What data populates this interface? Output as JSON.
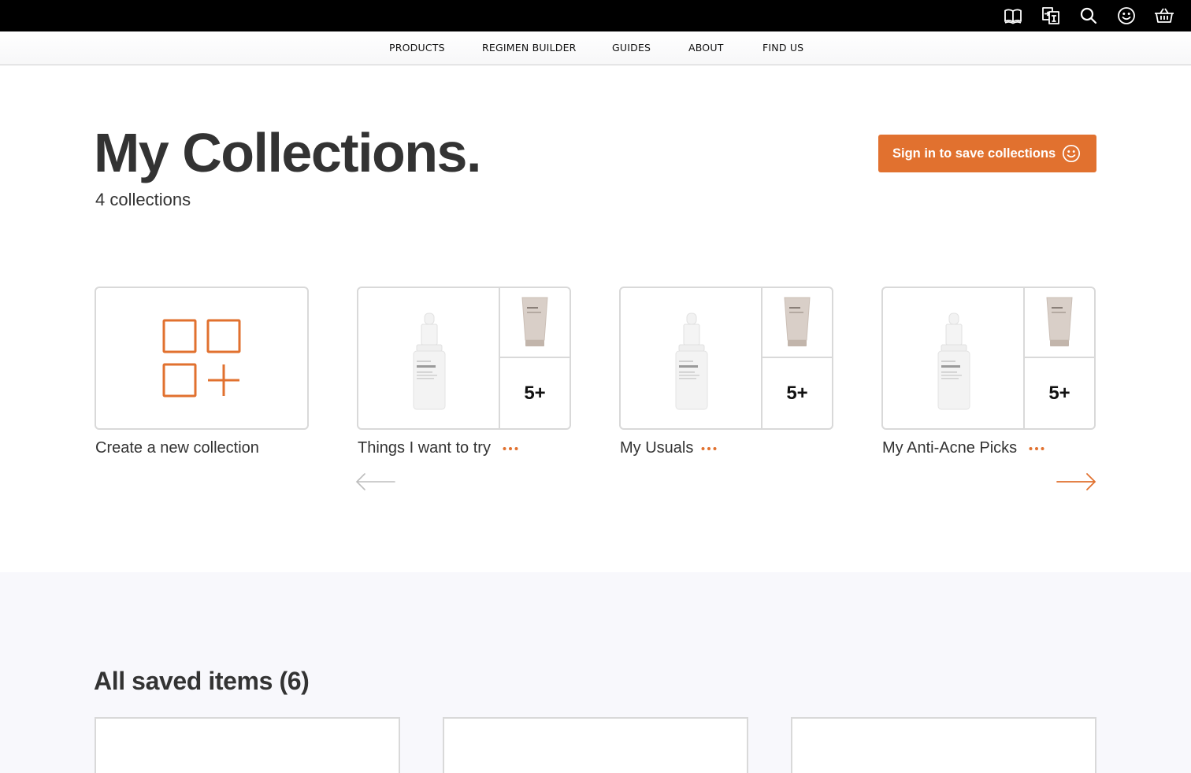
{
  "header": {
    "icons": [
      "book-icon",
      "translate-icon",
      "search-icon",
      "account-smiley-icon",
      "basket-icon"
    ]
  },
  "nav": {
    "items": [
      "PRODUCTS",
      "REGIMEN BUILDER",
      "GUIDES",
      "ABOUT",
      "FIND US"
    ]
  },
  "page": {
    "title": "My Collections.",
    "subtitle": "4 collections"
  },
  "signin": {
    "label": "Sign in to save collections",
    "icon": "smiley-icon"
  },
  "collections": {
    "new_label": "Create a new collection",
    "items": [
      {
        "name": "Things I want to try",
        "count_label": "5+"
      },
      {
        "name": "My Usuals",
        "count_label": "5+"
      },
      {
        "name": "My Anti-Acne Picks",
        "count_label": "5+"
      }
    ]
  },
  "saved": {
    "title": "All saved items (6)"
  },
  "colors": {
    "accent": "#e1712f",
    "topbar": "#000000",
    "text": "#333333",
    "border": "#d9d9d9",
    "section_bg": "#f8f8fc"
  }
}
